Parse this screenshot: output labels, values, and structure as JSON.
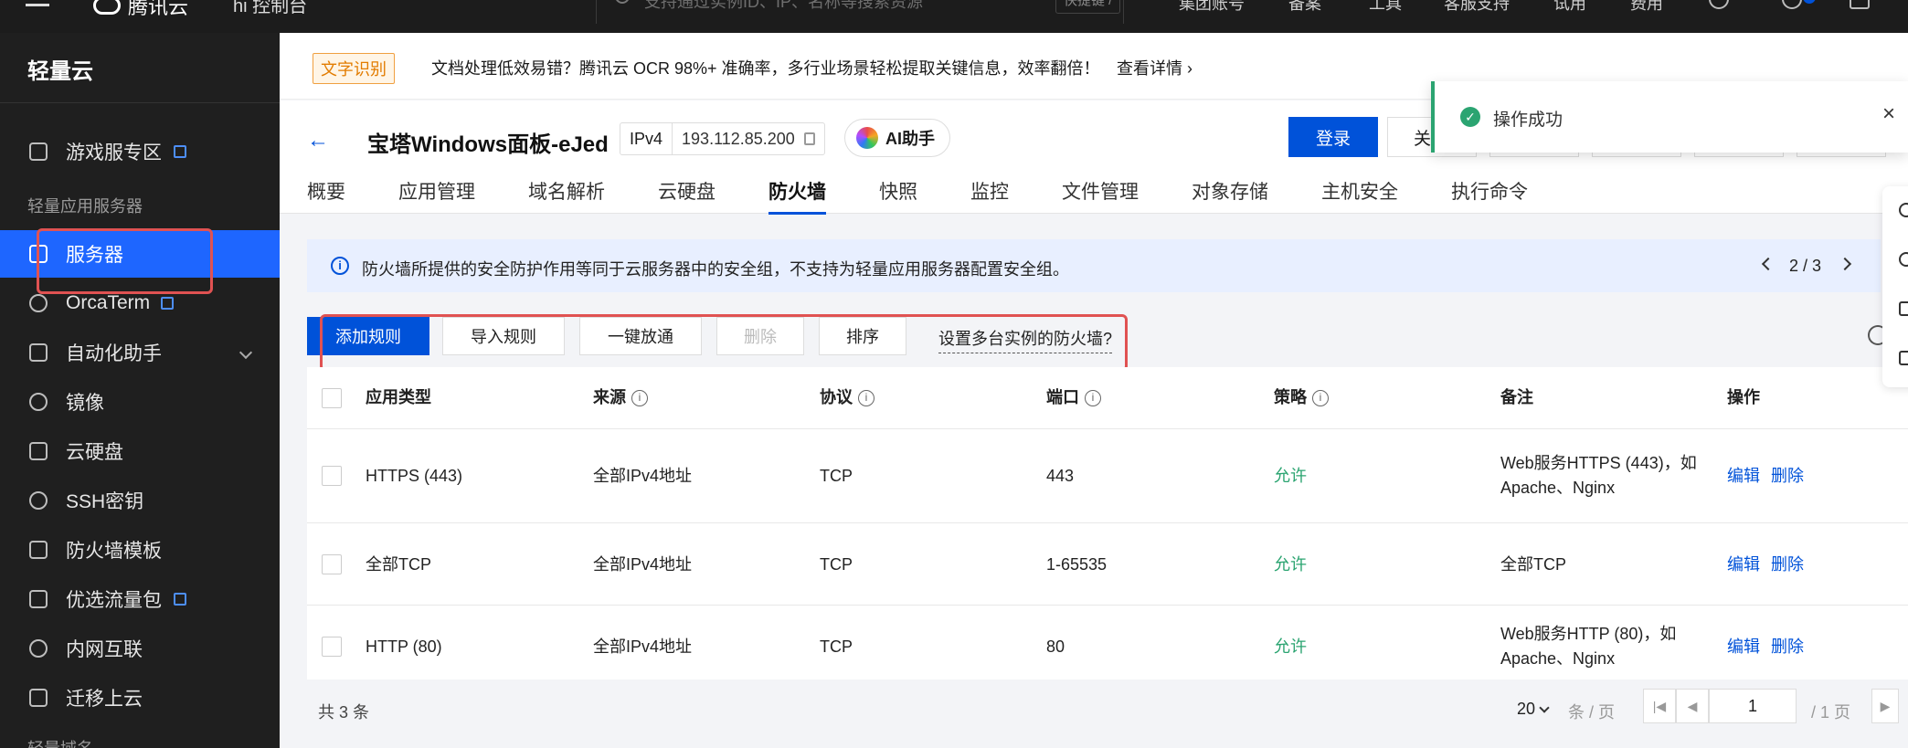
{
  "topbar": {
    "logo": "腾讯云",
    "console": "hi 控制台",
    "search_placeholder": "支持通过实例ID、IP、名称等搜索资源",
    "search_shortcut": "快捷键 /",
    "nav": [
      "集团账号",
      "备案",
      "工具",
      "客服支持",
      "试用",
      "费用"
    ]
  },
  "sidebar": {
    "title": "轻量云",
    "items": [
      {
        "label": "游戏服专区",
        "external": true
      },
      {
        "label": "服务器",
        "active": true
      },
      {
        "label": "OrcaTerm",
        "external": true
      },
      {
        "label": "自动化助手"
      },
      {
        "label": "镜像"
      },
      {
        "label": "云硬盘"
      },
      {
        "label": "SSH密钥"
      },
      {
        "label": "防火墙模板"
      },
      {
        "label": "优选流量包",
        "external": true
      },
      {
        "label": "内网互联"
      },
      {
        "label": "迁移上云"
      }
    ],
    "group_label": "轻量应用服务器",
    "group_label_2": "轻量域名"
  },
  "announcement": {
    "tag": "文字识别",
    "text": "文档处理低效易错？腾讯云 OCR 98%+ 准确率，多行业场景轻松提取关键信息，效率翻倍！",
    "link": "查看详情"
  },
  "instance": {
    "name": "宝塔Windows面板-eJed",
    "ip_proto": "IPv4",
    "ip_addr": "193.112.85.200",
    "ai_label": "AI助手",
    "login_label": "登录",
    "shutdown_label": "关"
  },
  "tabs": [
    "概要",
    "应用管理",
    "域名解析",
    "云硬盘",
    "防火墙",
    "快照",
    "监控",
    "文件管理",
    "对象存储",
    "主机安全",
    "执行命令"
  ],
  "active_tab": "防火墙",
  "banner": {
    "text": "防火墙所提供的安全防护作用等同于云服务器中的安全组，不支持为轻量应用服务器配置安全组。",
    "pager": "2 / 3"
  },
  "toolbar": {
    "add_rule": "添加规则",
    "import_rule": "导入规则",
    "one_click": "一键放通",
    "delete": "删除",
    "sort": "排序",
    "multi_instance": "设置多台实例的防火墙?"
  },
  "table": {
    "headers": [
      "应用类型",
      "来源",
      "协议",
      "端口",
      "策略",
      "备注",
      "操作"
    ],
    "rows": [
      {
        "app": "HTTPS (443)",
        "source": "全部IPv4地址",
        "protocol": "TCP",
        "port": "443",
        "policy": "允许",
        "note1": "Web服务HTTPS (443)，如",
        "note2": "Apache、Nginx",
        "edit": "编辑",
        "del": "删除"
      },
      {
        "app": "全部TCP",
        "source": "全部IPv4地址",
        "protocol": "TCP",
        "port": "1-65535",
        "policy": "允许",
        "note1": "全部TCP",
        "note2": "",
        "edit": "编辑",
        "del": "删除"
      },
      {
        "app": "HTTP (80)",
        "source": "全部IPv4地址",
        "protocol": "TCP",
        "port": "80",
        "policy": "允许",
        "note1": "Web服务HTTP (80)，如",
        "note2": "Apache、Nginx",
        "edit": "编辑",
        "del": "删除"
      }
    ]
  },
  "pagination": {
    "total": "共 3 条",
    "page_size": "20",
    "per_page": "条 / 页",
    "current_page": "1",
    "total_pages": "/ 1 页"
  },
  "toast": {
    "message": "操作成功"
  },
  "colors": {
    "primary": "#0052d9",
    "success": "#2ba471",
    "sidebar_bg": "#1f1f1f",
    "highlight_box": "#e05252"
  }
}
